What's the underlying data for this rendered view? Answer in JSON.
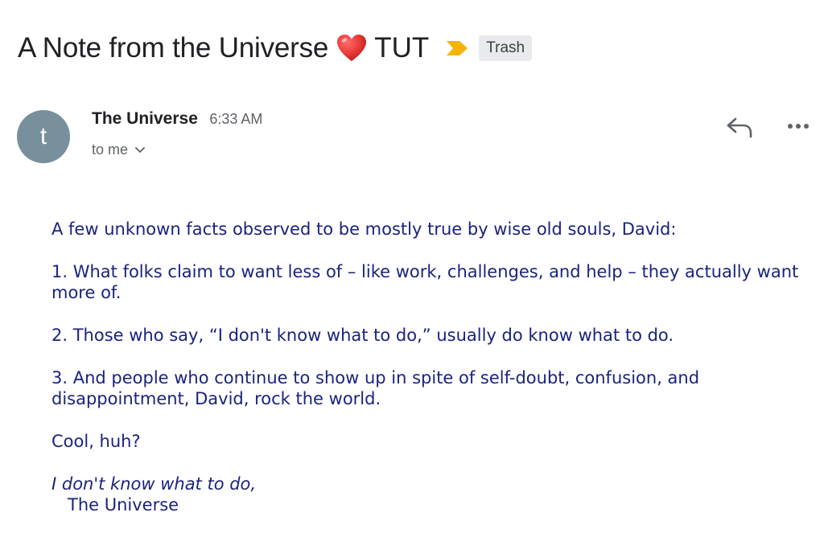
{
  "email": {
    "subject": "A Note from the Universe",
    "subject_tail": "TUT",
    "label": "Trash",
    "sender": {
      "name": "The Universe",
      "time": "6:33 AM",
      "avatar_letter": "t",
      "recipient": "to me"
    },
    "body": {
      "paragraphs": [
        "A few unknown facts observed to be mostly true by wise old souls, David:",
        "1. What folks claim to want less of – like work, challenges, and help – they actually want more of.",
        "2. Those who say, “I don't know what to do,” usually do know what to do.",
        "3. And people who continue to show up in spite of self-doubt, confusion, and disappointment, David, rock the world.",
        "Cool, huh?"
      ],
      "closing": "I don't know what to do,",
      "signature": "The Universe"
    }
  },
  "icons": {
    "heart": "heart-icon",
    "importance": "importance-marker-icon",
    "reply": "reply-icon",
    "more": "more-options-icon",
    "chevron": "chevron-down-icon"
  },
  "colors": {
    "avatar_bg": "#78909c",
    "importance": "#f4b400",
    "heart": "#e53935",
    "body_text": "#1a237e",
    "label_bg": "#e8eaed"
  }
}
